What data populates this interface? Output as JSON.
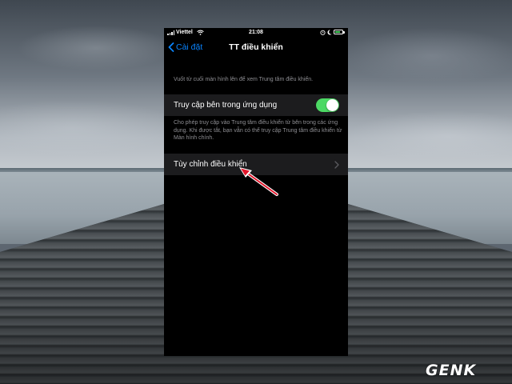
{
  "status_bar": {
    "carrier": "Viettel",
    "time": "21:08",
    "battery_percent_label": "",
    "battery_level": 0.8,
    "icons": [
      "signal-icon",
      "wifi-icon",
      "alarm-icon",
      "moon-icon",
      "battery-icon"
    ]
  },
  "nav": {
    "back_label": "Cài đặt",
    "title": "TT điều khiển"
  },
  "hint": "Vuốt từ cuối màn hình lên để xem Trung tâm điều khiển.",
  "access_in_apps": {
    "label": "Truy cập bên trong ứng dụng",
    "enabled": true,
    "footer": "Cho phép truy cập vào Trung tâm điều khiển từ bên trong các ứng dụng. Khi được tắt, bạn vẫn có thể truy cập Trung tâm điều khiển từ Màn hình chính."
  },
  "customize": {
    "label": "Tùy chỉnh điều khiển"
  },
  "watermark": "GENK",
  "colors": {
    "accent": "#0a84ff",
    "toggle_on": "#4cd964",
    "annotation_arrow": "#e3172b"
  }
}
